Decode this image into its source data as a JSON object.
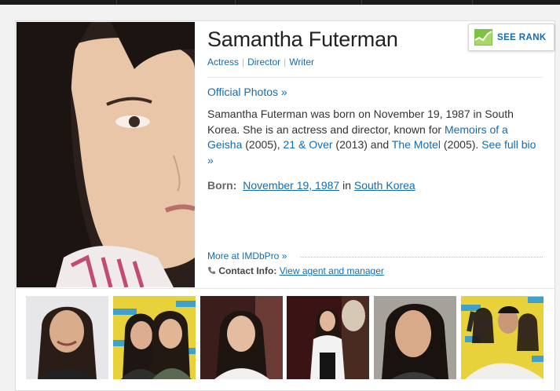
{
  "profile": {
    "name": "Samantha Futerman",
    "roles": [
      "Actress",
      "Director",
      "Writer"
    ],
    "official_photos": "Official Photos »",
    "bio": {
      "intro": "Samantha Futerman was born on November 19, 1987 in South Korea. She is an actress and director, known for",
      "film1": "Memoirs of a Geisha",
      "film1_year": "(2005),",
      "film2": "21 & Over",
      "film2_year": "(2013) and",
      "film3": "The Motel",
      "film3_year": "(2005).",
      "full_bio": "See full bio »"
    },
    "born": {
      "label": "Born:",
      "date": "November 19, 1987",
      "in_word": "in",
      "place": "South Korea"
    },
    "more_link": "More at IMDbPro »",
    "contact": {
      "label": "Contact Info:",
      "link": "View agent and manager"
    }
  },
  "rank_button": {
    "label": "SEE RANK",
    "icon": "rank-chart-icon"
  },
  "icons": {
    "phone": "phone-icon"
  },
  "colors": {
    "link": "#136cb2",
    "rank_icon": "#7dc243"
  },
  "photo_strip": {
    "count": 6
  }
}
